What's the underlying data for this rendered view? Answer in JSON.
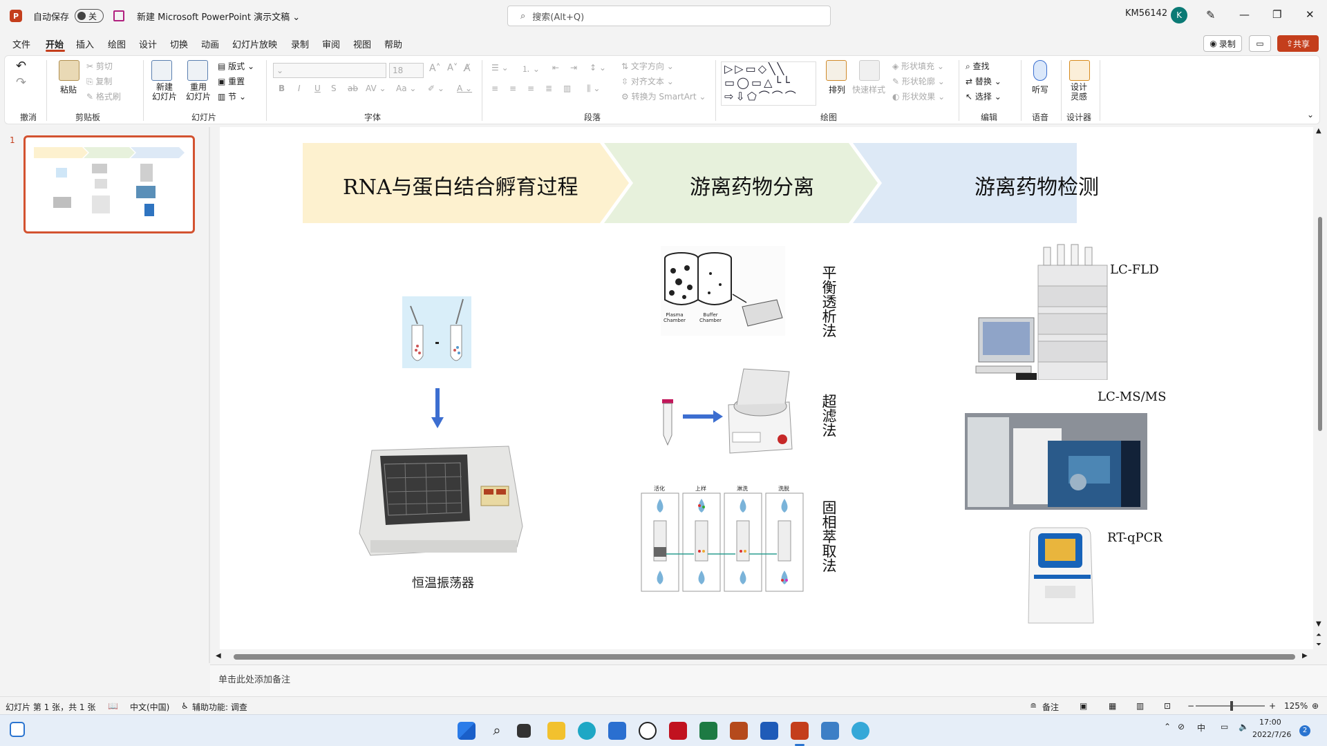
{
  "window": {
    "autosave_label": "自动保存",
    "autosave_state": "关",
    "doc_title": "新建 Microsoft PowerPoint 演示文稿 ⌄",
    "search_placeholder": "搜索(Alt+Q)",
    "user": "KM56142",
    "avatar": "K"
  },
  "menu": {
    "items": [
      "文件",
      "开始",
      "插入",
      "绘图",
      "设计",
      "切换",
      "动画",
      "幻灯片放映",
      "录制",
      "审阅",
      "视图",
      "帮助"
    ],
    "record": "录制",
    "share": "共享"
  },
  "ribbon": {
    "undo_group": "撤消",
    "clipboard": {
      "paste": "粘贴",
      "cut": "剪切",
      "copy": "复制",
      "format_painter": "格式刷",
      "label": "剪贴板"
    },
    "slides": {
      "new_slide": "新建\n幻灯片",
      "reuse": "重用\n幻灯片",
      "layout": "版式",
      "reset": "重置",
      "section": "节",
      "label": "幻灯片"
    },
    "font": {
      "size": "18",
      "label": "字体"
    },
    "paragraph": {
      "text_direction": "文字方向",
      "align_text": "对齐文本",
      "smartart": "转换为 SmartArt",
      "label": "段落"
    },
    "drawing": {
      "arrange": "排列",
      "quick_styles": "快速样式",
      "fill": "形状填充",
      "outline": "形状轮廓",
      "effects": "形状效果",
      "label": "绘图"
    },
    "editing": {
      "find": "查找",
      "replace": "替换",
      "select": "选择",
      "label": "编辑"
    },
    "voice": {
      "dictate": "听写",
      "label": "语音"
    },
    "designer": {
      "design_ideas": "设计\n灵感",
      "label": "设计器"
    }
  },
  "thumbnail": {
    "number": "1"
  },
  "slide": {
    "headers": [
      "RNA与蛋白结合孵育过程",
      "游离药物分离",
      "游离药物检测"
    ],
    "shaker_label": "恒温振荡器",
    "methods": [
      "平衡透析法",
      "超滤法",
      "固相萃取法"
    ],
    "chambers": [
      "Plasma\nChamber",
      "Buffer\nChamber"
    ],
    "spe_steps": [
      "活化",
      "上样",
      "淋洗",
      "洗脱"
    ],
    "instruments": [
      "LC-FLD",
      "LC-MS/MS",
      "RT-qPCR"
    ]
  },
  "notes_placeholder": "单击此处添加备注",
  "status": {
    "slide_count": "幻灯片 第 1 张，共 1 张",
    "language": "中文(中国)",
    "accessibility": "辅助功能: 调查",
    "notes": "备注",
    "zoom": "125%"
  },
  "taskbar": {
    "ime": "中",
    "time": "17:00",
    "date": "2022/7/26",
    "badge": "2"
  },
  "colors": {
    "accent": "#c43e1c",
    "chevron1": "#fdf1cf",
    "chevron2": "#e7f1dc",
    "chevron3": "#dde9f6",
    "arrow": "#3c6ed0"
  }
}
